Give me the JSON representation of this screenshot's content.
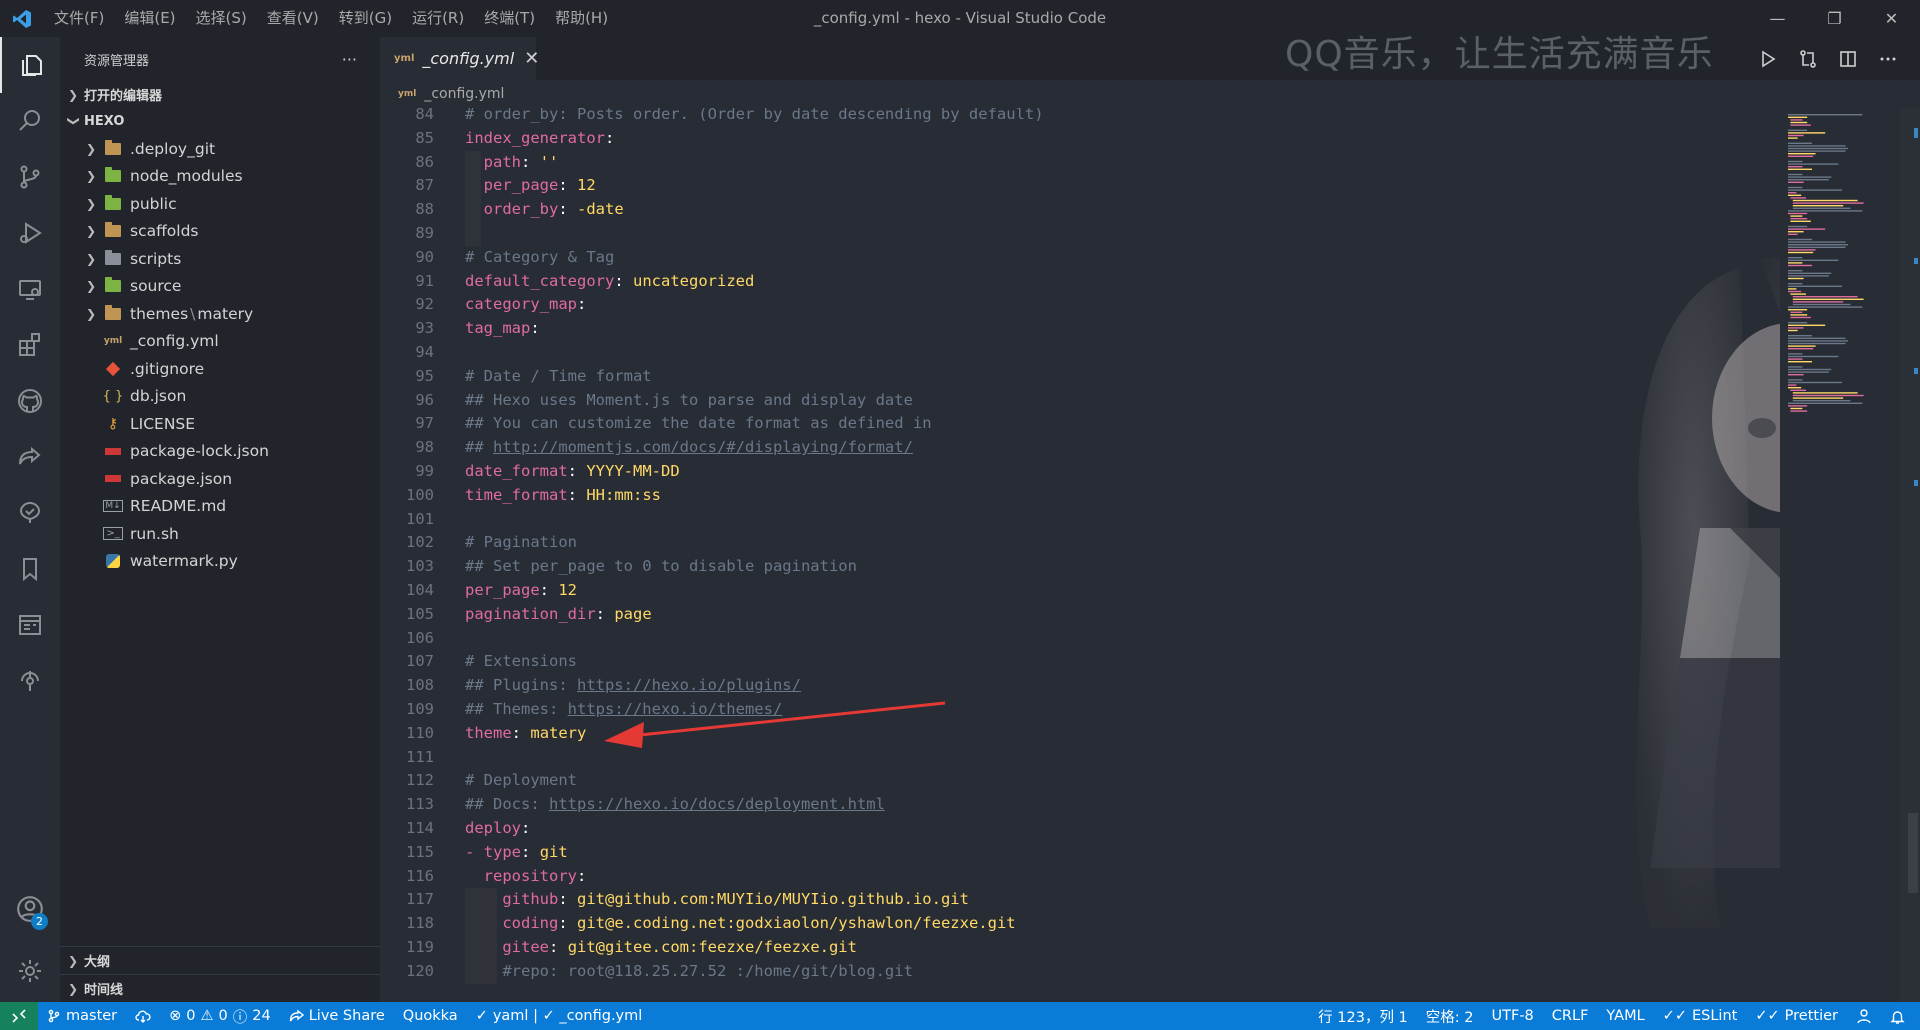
{
  "window": {
    "title": "_config.yml - hexo - Visual Studio Code",
    "menu": [
      "文件(F)",
      "编辑(E)",
      "选择(S)",
      "查看(V)",
      "转到(G)",
      "运行(R)",
      "终端(T)",
      "帮助(H)"
    ],
    "watermark": "QQ音乐，让生活充满音乐"
  },
  "sidebar": {
    "title": "资源管理器",
    "more": "···",
    "open_editors": "打开的编辑器",
    "root": "HEXO",
    "items": [
      {
        "name": "deploy-git",
        "label": ".deploy_git",
        "type": "folder",
        "color": "#c09553"
      },
      {
        "name": "node-modules",
        "label": "node_modules",
        "type": "folder",
        "color": "#7cb342"
      },
      {
        "name": "public",
        "label": "public",
        "type": "folder",
        "color": "#7cb342"
      },
      {
        "name": "scaffolds",
        "label": "scaffolds",
        "type": "folder",
        "color": "#c09553"
      },
      {
        "name": "scripts",
        "label": "scripts",
        "type": "folder",
        "color": "#8a8f99"
      },
      {
        "name": "source",
        "label": "source",
        "type": "folder",
        "color": "#7cb342"
      },
      {
        "name": "themes",
        "label": "themes",
        "sub": "matery",
        "type": "folder",
        "color": "#c09553"
      },
      {
        "name": "config-yml",
        "label": "_config.yml",
        "type": "yaml-file"
      },
      {
        "name": "gitignore",
        "label": ".gitignore",
        "type": "git-file"
      },
      {
        "name": "db-json",
        "label": "db.json",
        "type": "json-file"
      },
      {
        "name": "license",
        "label": "LICENSE",
        "type": "license-file"
      },
      {
        "name": "package-lock-json",
        "label": "package-lock.json",
        "type": "npm-file"
      },
      {
        "name": "package-json",
        "label": "package.json",
        "type": "npm-file"
      },
      {
        "name": "readme-md",
        "label": "README.md",
        "type": "md-file"
      },
      {
        "name": "run-sh",
        "label": "run.sh",
        "type": "shell-file"
      },
      {
        "name": "watermark-py",
        "label": "watermark.py",
        "type": "python-file"
      }
    ],
    "outline": "大纲",
    "timeline": "时间线"
  },
  "activity_bar": {
    "icons": [
      "explorer-icon",
      "search-icon",
      "source-control-icon",
      "run-debug-icon",
      "remote-explorer-icon",
      "extensions-icon",
      "github-icon",
      "live-share-icon",
      "test-icon",
      "bookmark-icon",
      "preview-icon",
      "timeline-icon",
      "accounts-icon",
      "settings-gear-icon"
    ],
    "accounts_badge": "2"
  },
  "tabs": [
    {
      "label": "_config.yml",
      "icon": "yaml-icon",
      "close": "✕"
    }
  ],
  "breadcrumb": {
    "file": "_config.yml"
  },
  "editor": {
    "lines": [
      {
        "n": "84",
        "c": "# order_by: Posts order. (Order by date descending by default)"
      },
      {
        "n": "85",
        "c": "index_generator:"
      },
      {
        "n": "86",
        "c": "  path: ''"
      },
      {
        "n": "87",
        "c": "  per_page: 12"
      },
      {
        "n": "88",
        "c": "  order_by: -date"
      },
      {
        "n": "89",
        "c": ""
      },
      {
        "n": "90",
        "c": "# Category & Tag"
      },
      {
        "n": "91",
        "c": "default_category: uncategorized"
      },
      {
        "n": "92",
        "c": "category_map:"
      },
      {
        "n": "93",
        "c": "tag_map:"
      },
      {
        "n": "94",
        "c": ""
      },
      {
        "n": "95",
        "c": "# Date / Time format"
      },
      {
        "n": "96",
        "c": "## Hexo uses Moment.js to parse and display date"
      },
      {
        "n": "97",
        "c": "## You can customize the date format as defined in"
      },
      {
        "n": "98",
        "c": "## http://momentjs.com/docs/#/displaying/format/"
      },
      {
        "n": "99",
        "c": "date_format: YYYY-MM-DD"
      },
      {
        "n": "100",
        "c": "time_format: HH:mm:ss"
      },
      {
        "n": "101",
        "c": ""
      },
      {
        "n": "102",
        "c": "# Pagination"
      },
      {
        "n": "103",
        "c": "## Set per_page to 0 to disable pagination"
      },
      {
        "n": "104",
        "c": "per_page: 12"
      },
      {
        "n": "105",
        "c": "pagination_dir: page"
      },
      {
        "n": "106",
        "c": ""
      },
      {
        "n": "107",
        "c": "# Extensions"
      },
      {
        "n": "108",
        "c": "## Plugins: https://hexo.io/plugins/"
      },
      {
        "n": "109",
        "c": "## Themes: https://hexo.io/themes/"
      },
      {
        "n": "110",
        "c": "theme: matery"
      },
      {
        "n": "111",
        "c": ""
      },
      {
        "n": "112",
        "c": "# Deployment"
      },
      {
        "n": "113",
        "c": "## Docs: https://hexo.io/docs/deployment.html"
      },
      {
        "n": "114",
        "c": "deploy:"
      },
      {
        "n": "115",
        "c": "- type: git"
      },
      {
        "n": "116",
        "c": "  repository:"
      },
      {
        "n": "117",
        "c": "    github: git@github.com:MUYIio/MUYIio.github.io.git"
      },
      {
        "n": "118",
        "c": "    coding: git@e.coding.net:godxiaolon/yshawlon/feezxe.git"
      },
      {
        "n": "119",
        "c": "    gitee: git@gitee.com:feezxe/feezxe.git"
      },
      {
        "n": "120",
        "c": "    #repo: root@118.25.27.52 :/home/git/blog.git"
      }
    ]
  },
  "statusbar": {
    "remote": "remote-icon",
    "branch": "master",
    "errors": "0",
    "warnings": "0",
    "info": "24",
    "live_share": "Live Share",
    "quokka": "Quokka",
    "yaml_check": "yaml | ✓ _config.yml",
    "cursor": "行 123，列 1",
    "spaces": "空格: 2",
    "encoding": "UTF-8",
    "eol": "CRLF",
    "language": "YAML",
    "eslint": "ESLint",
    "prettier": "Prettier"
  },
  "colors": {
    "statusbar": "#0a7bd6",
    "editor_bg": "#282c34",
    "sidebar_bg": "#21252b",
    "key": "#e06c9f",
    "value": "#ffd866",
    "comment": "#6a7889",
    "arrow": "#e53935"
  }
}
